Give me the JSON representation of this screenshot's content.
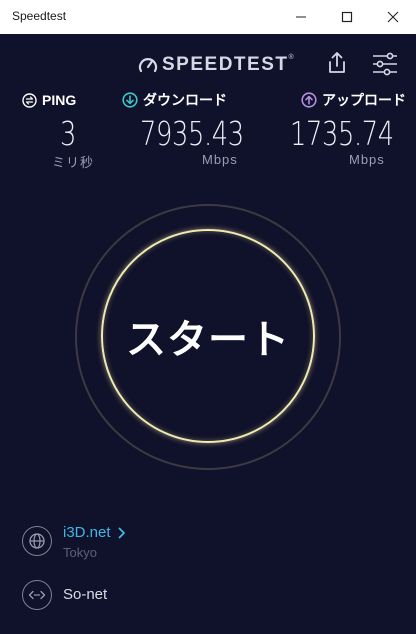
{
  "window": {
    "title": "Speedtest"
  },
  "header": {
    "logo_text": "SPEEDTEST",
    "logo_mark": "®",
    "share_icon": "share-icon",
    "settings_icon": "settings-sliders-icon"
  },
  "metrics": {
    "ping": {
      "label": "PING",
      "value": "3",
      "unit": "ミリ秒",
      "icon": "ping-icon"
    },
    "download": {
      "label": "ダウンロード",
      "value": "7935.43",
      "unit": "Mbps",
      "icon": "download-arrow-icon",
      "accent": "#3fc6c8"
    },
    "upload": {
      "label": "アップロード",
      "value": "1735.74",
      "unit": "Mbps",
      "icon": "upload-arrow-icon",
      "accent": "#b28fe0"
    }
  },
  "start": {
    "label": "スタート",
    "ring_color": "#f0e9b0"
  },
  "server": {
    "name": "i3D.net",
    "location": "Tokyo",
    "icon": "globe-icon",
    "link_color": "#3fb7e8"
  },
  "isp": {
    "name": "So-net",
    "icon": "connection-icon"
  }
}
